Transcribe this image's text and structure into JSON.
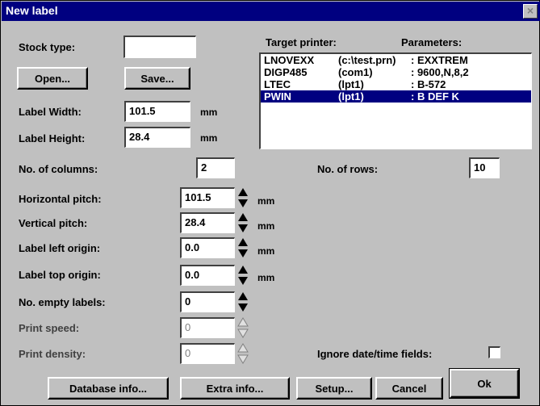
{
  "window": {
    "title": "New label",
    "close_glyph": "×"
  },
  "stock_type": {
    "label": "Stock type:",
    "value": ""
  },
  "buttons": {
    "open": "Open...",
    "save": "Save...",
    "database_info": "Database info...",
    "extra_info": "Extra info...",
    "setup": "Setup...",
    "cancel": "Cancel",
    "ok": "Ok"
  },
  "label_width": {
    "label": "Label Width:",
    "value": "101.5",
    "unit": "mm"
  },
  "label_height": {
    "label": "Label Height:",
    "value": "28.4",
    "unit": "mm"
  },
  "printer_list": {
    "header_target": "Target printer:",
    "header_params": "Parameters:",
    "rows": [
      {
        "name": "LNOVEXX",
        "port": "(c:\\test.prn)",
        "params": ": EXXTREM"
      },
      {
        "name": "DIGP485",
        "port": "(com1)",
        "params": ": 9600,N,8,2"
      },
      {
        "name": "LTEC",
        "port": "(lpt1)",
        "params": ": B-572"
      },
      {
        "name": "PWIN",
        "port": "(lpt1)",
        "params": ": B DEF K"
      }
    ]
  },
  "columns": {
    "label": "No. of columns:",
    "value": "2"
  },
  "rows_count": {
    "label": "No. of rows:",
    "value": "10"
  },
  "horizontal_pitch": {
    "label": "Horizontal pitch:",
    "value": "101.5",
    "unit": "mm"
  },
  "vertical_pitch": {
    "label": "Vertical pitch:",
    "value": "28.4",
    "unit": "mm"
  },
  "left_origin": {
    "label": "Label left origin:",
    "value": "0.0",
    "unit": "mm"
  },
  "top_origin": {
    "label": "Label top origin:",
    "value": "0.0",
    "unit": "mm"
  },
  "empty_labels": {
    "label": "No. empty labels:",
    "value": "0"
  },
  "print_speed": {
    "label": "Print speed:",
    "value": "0"
  },
  "print_density": {
    "label": "Print density:",
    "value": "0"
  },
  "ignore_datetime": {
    "label": "Ignore date/time fields:",
    "checked": false
  },
  "colors": {
    "titlebar": "#000080",
    "face": "#c0c0c0",
    "selection": "#000080"
  }
}
